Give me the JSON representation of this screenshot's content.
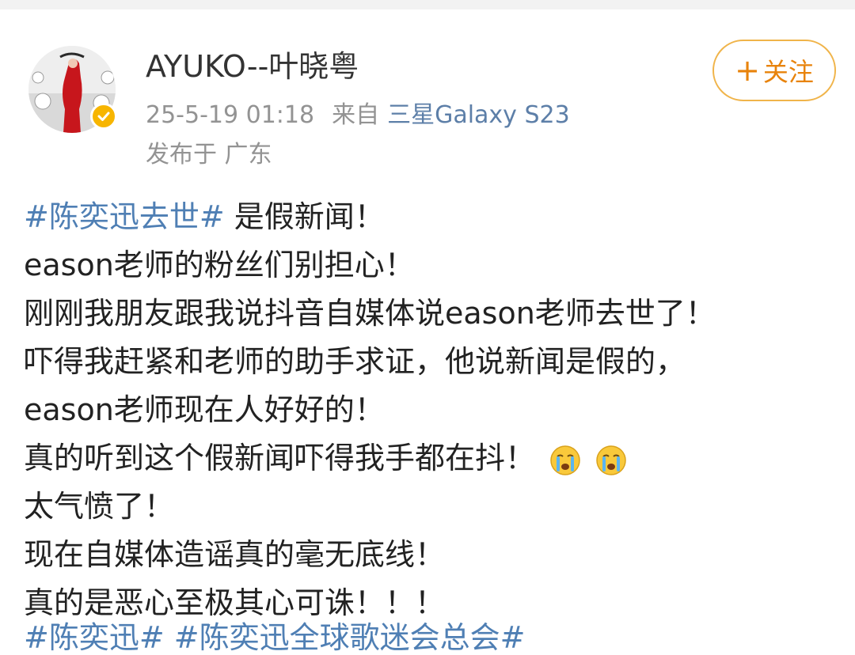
{
  "author": {
    "name": "AYUKO--叶晓粤",
    "timestamp": "25-5-19 01:18",
    "source_prefix": "来自",
    "device": "三星Galaxy S23",
    "location": "发布于 广东",
    "verified_icon": "verified-badge-icon",
    "avatar_icon": "avatar-image"
  },
  "follow": {
    "plus": "+",
    "label": "关注"
  },
  "post": {
    "hashtag": "#陈奕迅去世#",
    "first_line_rest": "是假新闻！",
    "lines": [
      "eason老师的粉丝们别担心！",
      "刚刚我朋友跟我说抖音自媒体说eason老师去世了！",
      "吓得我赶紧和老师的助手求证，他说新闻是假的，",
      "eason老师现在人好好的！",
      "真的听到这个假新闻吓得我手都在抖！",
      "太气愤了！",
      "现在自媒体造谣真的毫无底线！",
      "真的是恶心至极其心可诛！！！"
    ],
    "crying_emoji_icon": "crying-face-icon",
    "partial_tags": "#陈奕迅# #陈奕迅全球歌迷会总会#"
  },
  "colors": {
    "hashtag": "#4f7fb4",
    "follow_border": "#f0b44a",
    "follow_text": "#e8830b",
    "meta_gray": "#939393",
    "device_blue": "#5d7fa8",
    "verified_gold": "#f7b500"
  }
}
